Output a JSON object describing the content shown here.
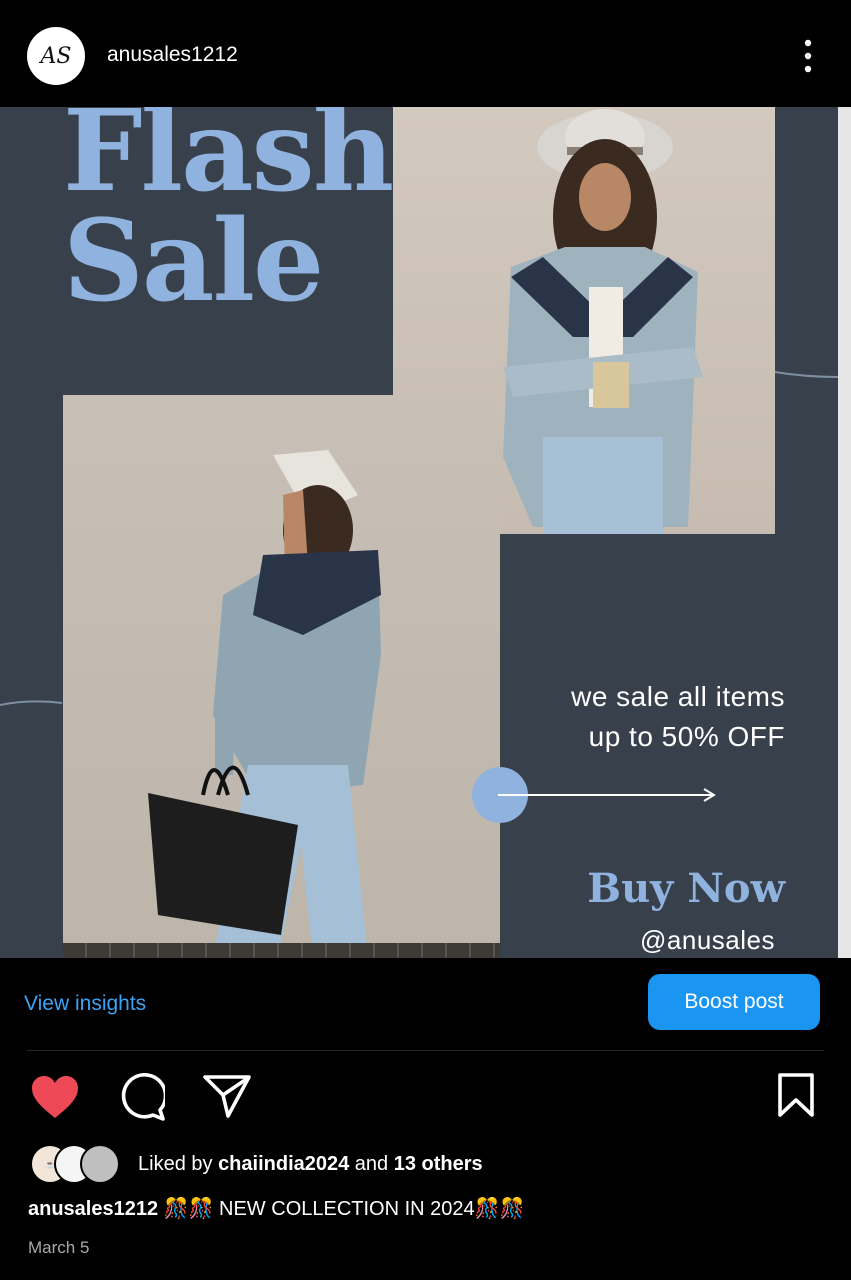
{
  "header": {
    "avatar_text": "AS",
    "username": "anusales1212"
  },
  "post": {
    "headline_line1": "Flash",
    "headline_line2": "Sale",
    "promo_line1": "we sale all items",
    "promo_line2": "up to 50% OFF",
    "cta": "Buy Now",
    "handle": "@anusales"
  },
  "actions": {
    "view_insights": "View insights",
    "boost_post": "Boost post"
  },
  "likes": {
    "prefix": "Liked by ",
    "user": "chaiindia2024",
    "suffix": " and ",
    "others": "13 others"
  },
  "caption": {
    "user": "anusales1212",
    "text": " 🎊🎊 NEW COLLECTION IN 2024🎊🎊"
  },
  "date": "March 5",
  "colors": {
    "accent_blue": "#1b95f2",
    "link_blue": "#3ba3f4",
    "like_red": "#ed4956",
    "post_bg": "#38404c",
    "headline_blue": "#8fb2de"
  },
  "icons": [
    "more-icon",
    "heart-icon",
    "comment-icon",
    "share-icon",
    "bookmark-icon"
  ]
}
